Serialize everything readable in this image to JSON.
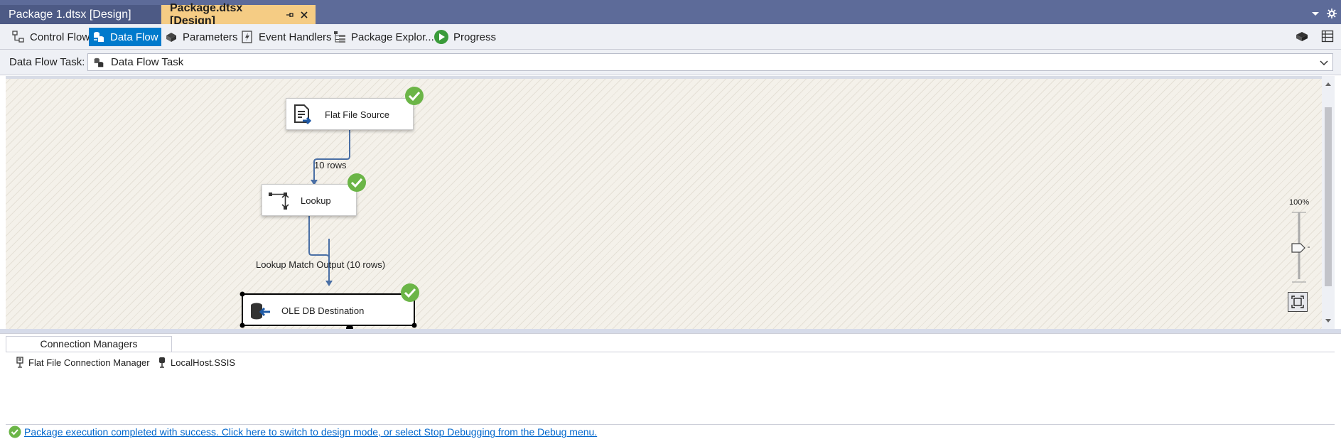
{
  "document_tabs": [
    {
      "label": "Package 1.dtsx [Design]",
      "active": false
    },
    {
      "label": "Package.dtsx [Design]",
      "active": true
    }
  ],
  "designer_tabs": [
    {
      "label": "Control Flow",
      "icon": "control-flow-icon",
      "selected": false
    },
    {
      "label": "Data Flow",
      "icon": "data-flow-icon",
      "selected": true
    },
    {
      "label": "Parameters",
      "icon": "parameters-icon",
      "selected": false
    },
    {
      "label": "Event Handlers",
      "icon": "event-handlers-icon",
      "selected": false
    },
    {
      "label": "Package Explor...",
      "icon": "package-explorer-icon",
      "selected": false
    },
    {
      "label": "Progress",
      "icon": "progress-icon",
      "selected": false
    }
  ],
  "task_selector": {
    "label": "Data Flow Task:",
    "value": "Data Flow Task"
  },
  "canvas": {
    "components": [
      {
        "name": "Flat File Source",
        "status": "success"
      },
      {
        "name": "Lookup",
        "status": "success"
      },
      {
        "name": "OLE DB Destination",
        "status": "success"
      }
    ],
    "paths": [
      {
        "from": "Flat File Source",
        "to": "Lookup",
        "label": "10 rows"
      },
      {
        "from": "Lookup",
        "to": "OLE DB Destination",
        "label": "Lookup Match Output (10 rows)"
      }
    ],
    "zoom": "100%"
  },
  "connection_managers": {
    "tab_label": "Connection Managers",
    "items": [
      "Flat File Connection Manager",
      "LocalHost.SSIS"
    ]
  },
  "status": {
    "message": "Package execution completed with success. Click here to switch to design mode, or select Stop Debugging from the Debug menu."
  },
  "colors": {
    "tab_strip": "#5d6b99",
    "active_tab": "#f5cc84",
    "selected_designer_tab": "#007acc",
    "success_green": "#6bb547",
    "path_blue": "#4a6fa5",
    "link": "#0066cc"
  }
}
